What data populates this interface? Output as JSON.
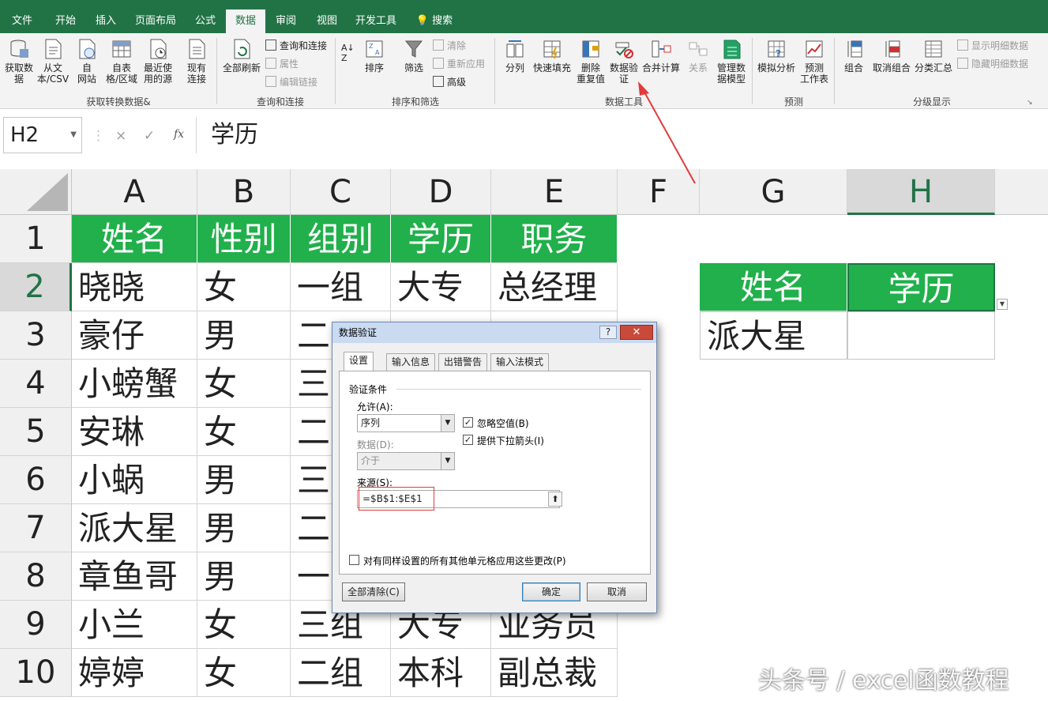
{
  "tabs": [
    {
      "label": "文件",
      "active": false
    },
    {
      "label": "开始",
      "active": false
    },
    {
      "label": "插入",
      "active": false
    },
    {
      "label": "页面布局",
      "active": false
    },
    {
      "label": "公式",
      "active": false
    },
    {
      "label": "数据",
      "active": true
    },
    {
      "label": "审阅",
      "active": false
    },
    {
      "label": "视图",
      "active": false
    },
    {
      "label": "开发工具",
      "active": false
    },
    {
      "label": "搜索",
      "active": false
    }
  ],
  "ribbon": {
    "get_data": "获取数\n据",
    "from_text": "从文\n本/CSV",
    "from_web": "自\n网站",
    "from_table": "自表\n格/区域",
    "recent": "最近使\n用的源",
    "existing": "现有\n连接",
    "refresh_all": "全部刷新",
    "queries": "查询和连接",
    "properties": "属性",
    "edit_links": "编辑链接",
    "sort": "排序",
    "filter": "筛选",
    "clear": "清除",
    "reapply": "重新应用",
    "advanced": "高级",
    "text_to_col": "分列",
    "flash_fill": "快速填充",
    "remove_dup": "删除\n重复值",
    "data_val": "数据验\n证",
    "consolidate": "合并计算",
    "relations": "关系",
    "data_model": "管理数\n据模型",
    "whatif": "模拟分析",
    "forecast": "预测\n工作表",
    "group": "组合",
    "ungroup": "取消组合",
    "subtotal": "分类汇总",
    "show_detail": "显示明细数据",
    "hide_detail": "隐藏明细数据",
    "groups": {
      "get_transform": "获取转换数据&",
      "query_conn": "查询和连接",
      "sort_filter": "排序和筛选",
      "data_tools": "数据工具",
      "forecast": "预测",
      "outline": "分级显示"
    }
  },
  "formula_bar": {
    "cell_ref": "H2",
    "fx_symbol": "fx",
    "cancel": "×",
    "confirm": "✓",
    "value": "学历"
  },
  "columns": [
    "A",
    "B",
    "C",
    "D",
    "E",
    "F",
    "G",
    "H"
  ],
  "rows": [
    "1",
    "2",
    "3",
    "4",
    "5",
    "6",
    "7",
    "8",
    "9",
    "10"
  ],
  "table": {
    "headers": [
      "姓名",
      "性别",
      "组别",
      "学历",
      "职务"
    ],
    "rows": [
      [
        "晓晓",
        "女",
        "一组",
        "大专",
        "总经理"
      ],
      [
        "豪仔",
        "男",
        "二",
        "",
        ""
      ],
      [
        "小螃蟹",
        "女",
        "三",
        "",
        ""
      ],
      [
        "安琳",
        "女",
        "二",
        "",
        ""
      ],
      [
        "小蜗",
        "男",
        "三",
        "",
        ""
      ],
      [
        "派大星",
        "男",
        "二",
        "",
        ""
      ],
      [
        "章鱼哥",
        "男",
        "一",
        "",
        ""
      ],
      [
        "小兰",
        "女",
        "三组",
        "大专",
        "业务员"
      ],
      [
        "婷婷",
        "女",
        "二组",
        "本科",
        "副总裁"
      ]
    ]
  },
  "lookup": {
    "header1": "姓名",
    "header2": "学历",
    "name_value": "派大星"
  },
  "dialog": {
    "title": "数据验证",
    "help": "?",
    "close": "✕",
    "tabs": [
      "设置",
      "输入信息",
      "出错警告",
      "输入法模式"
    ],
    "section": "验证条件",
    "allow_label": "允许(A):",
    "allow_value": "序列",
    "ignore_blank": "忽略空值(B)",
    "dropdown": "提供下拉箭头(I)",
    "data_label": "数据(D):",
    "data_value": "介于",
    "source_label": "来源(S):",
    "source_value": "=$B$1:$E$1",
    "apply_all": "对有同样设置的所有其他单元格应用这些更改(P)",
    "clear_all": "全部清除(C)",
    "ok": "确定",
    "cancel": "取消"
  },
  "watermark": "头条号 / excel函数教程",
  "colors": {
    "excel_green": "#217346",
    "header_fill": "#21b04b",
    "annotation_red": "#e23b3b"
  }
}
